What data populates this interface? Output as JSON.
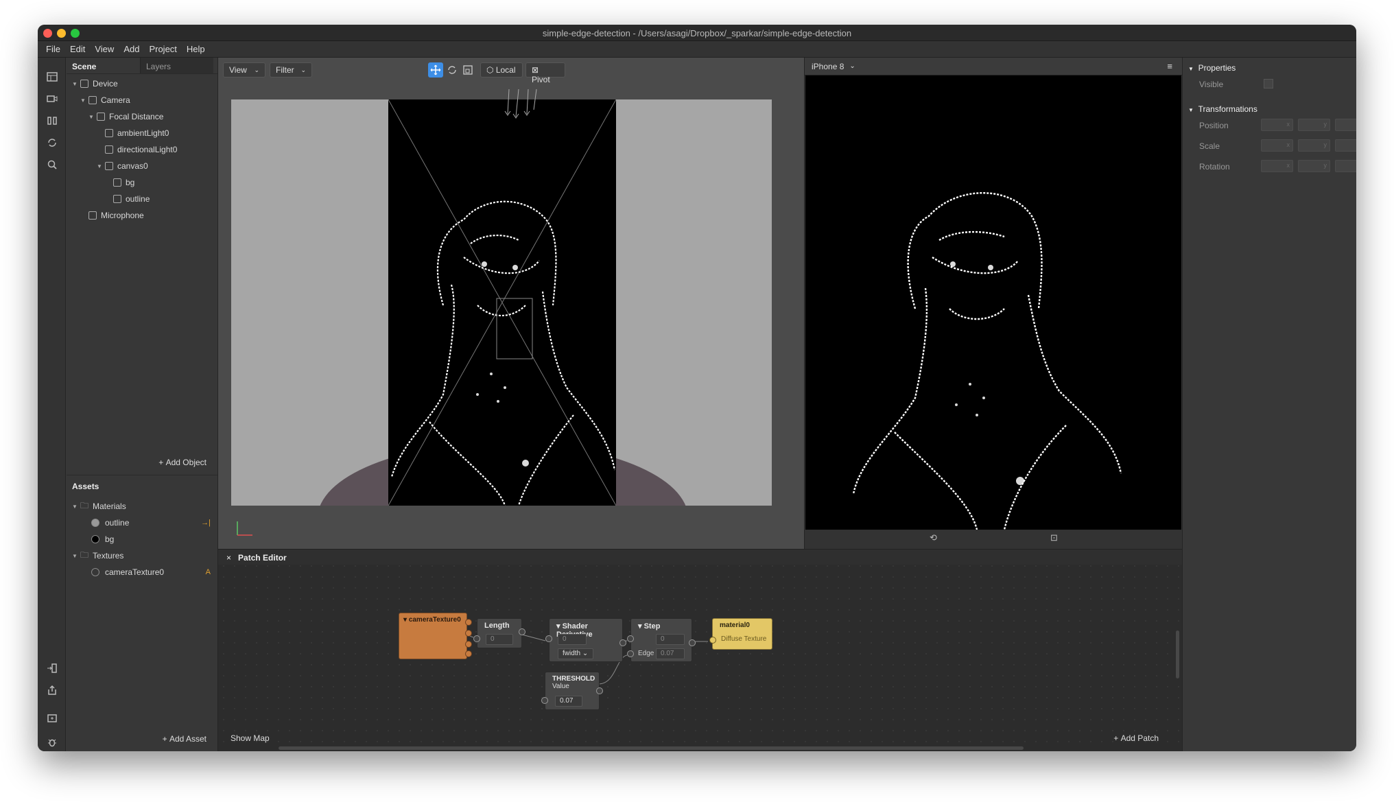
{
  "window": {
    "title": "simple-edge-detection - /Users/asagi/Dropbox/_sparkar/simple-edge-detection"
  },
  "menu": [
    "File",
    "Edit",
    "View",
    "Add",
    "Project",
    "Help"
  ],
  "scene": {
    "tabs": [
      "Scene",
      "Layers"
    ],
    "tree": [
      {
        "label": "Device",
        "icon": "phone-icon",
        "depth": 0,
        "caret": true
      },
      {
        "label": "Camera",
        "icon": "camera-icon",
        "depth": 1,
        "caret": true
      },
      {
        "label": "Focal Distance",
        "icon": "focal-icon",
        "depth": 2,
        "caret": true
      },
      {
        "label": "ambientLight0",
        "icon": "globe-icon",
        "depth": 3,
        "caret": false
      },
      {
        "label": "directionalLight0",
        "icon": "light-icon",
        "depth": 3,
        "caret": false
      },
      {
        "label": "canvas0",
        "icon": "canvas-icon",
        "depth": 3,
        "caret": true
      },
      {
        "label": "bg",
        "icon": "square-icon",
        "depth": 4,
        "caret": false
      },
      {
        "label": "outline",
        "icon": "square-icon",
        "depth": 4,
        "caret": false
      },
      {
        "label": "Microphone",
        "icon": "microphone-icon",
        "depth": 1,
        "caret": false
      }
    ],
    "add_object": "Add Object"
  },
  "assets": {
    "title": "Assets",
    "groups": [
      {
        "label": "Materials",
        "items": [
          {
            "label": "outline",
            "badge": "→|"
          },
          {
            "label": "bg",
            "badge": ""
          }
        ]
      },
      {
        "label": "Textures",
        "items": [
          {
            "label": "cameraTexture0",
            "badge": "A"
          }
        ]
      }
    ],
    "add_asset": "Add Asset"
  },
  "viewport": {
    "view": "View",
    "filter": "Filter",
    "local": "Local",
    "pivot": "Pivot"
  },
  "simulator": {
    "device": "iPhone 8"
  },
  "properties": {
    "section1": "Properties",
    "visible": "Visible",
    "section2": "Transformations",
    "rows": [
      "Position",
      "Scale",
      "Rotation"
    ],
    "axes": [
      "x",
      "y",
      "z"
    ]
  },
  "patch_editor": {
    "title": "Patch Editor",
    "show_map": "Show Map",
    "add_patch": "Add Patch",
    "nodes": {
      "camera": "cameraTexture0",
      "length": {
        "title": "Length",
        "value": "0"
      },
      "deriv": {
        "title": "Shader Derivative",
        "value": "0",
        "mode": "fwidth"
      },
      "step": {
        "title": "Step",
        "value": "0",
        "edge_label": "Edge",
        "edge": "0.07"
      },
      "threshold": {
        "title": "THRESHOLD",
        "sub": "Value",
        "value": "0.07"
      },
      "material": {
        "title": "material0",
        "port": "Diffuse Texture"
      }
    }
  },
  "colors": {
    "accent": "#3d8ee6",
    "camera_node": "#c77b3f",
    "material_node": "#e3c766"
  }
}
